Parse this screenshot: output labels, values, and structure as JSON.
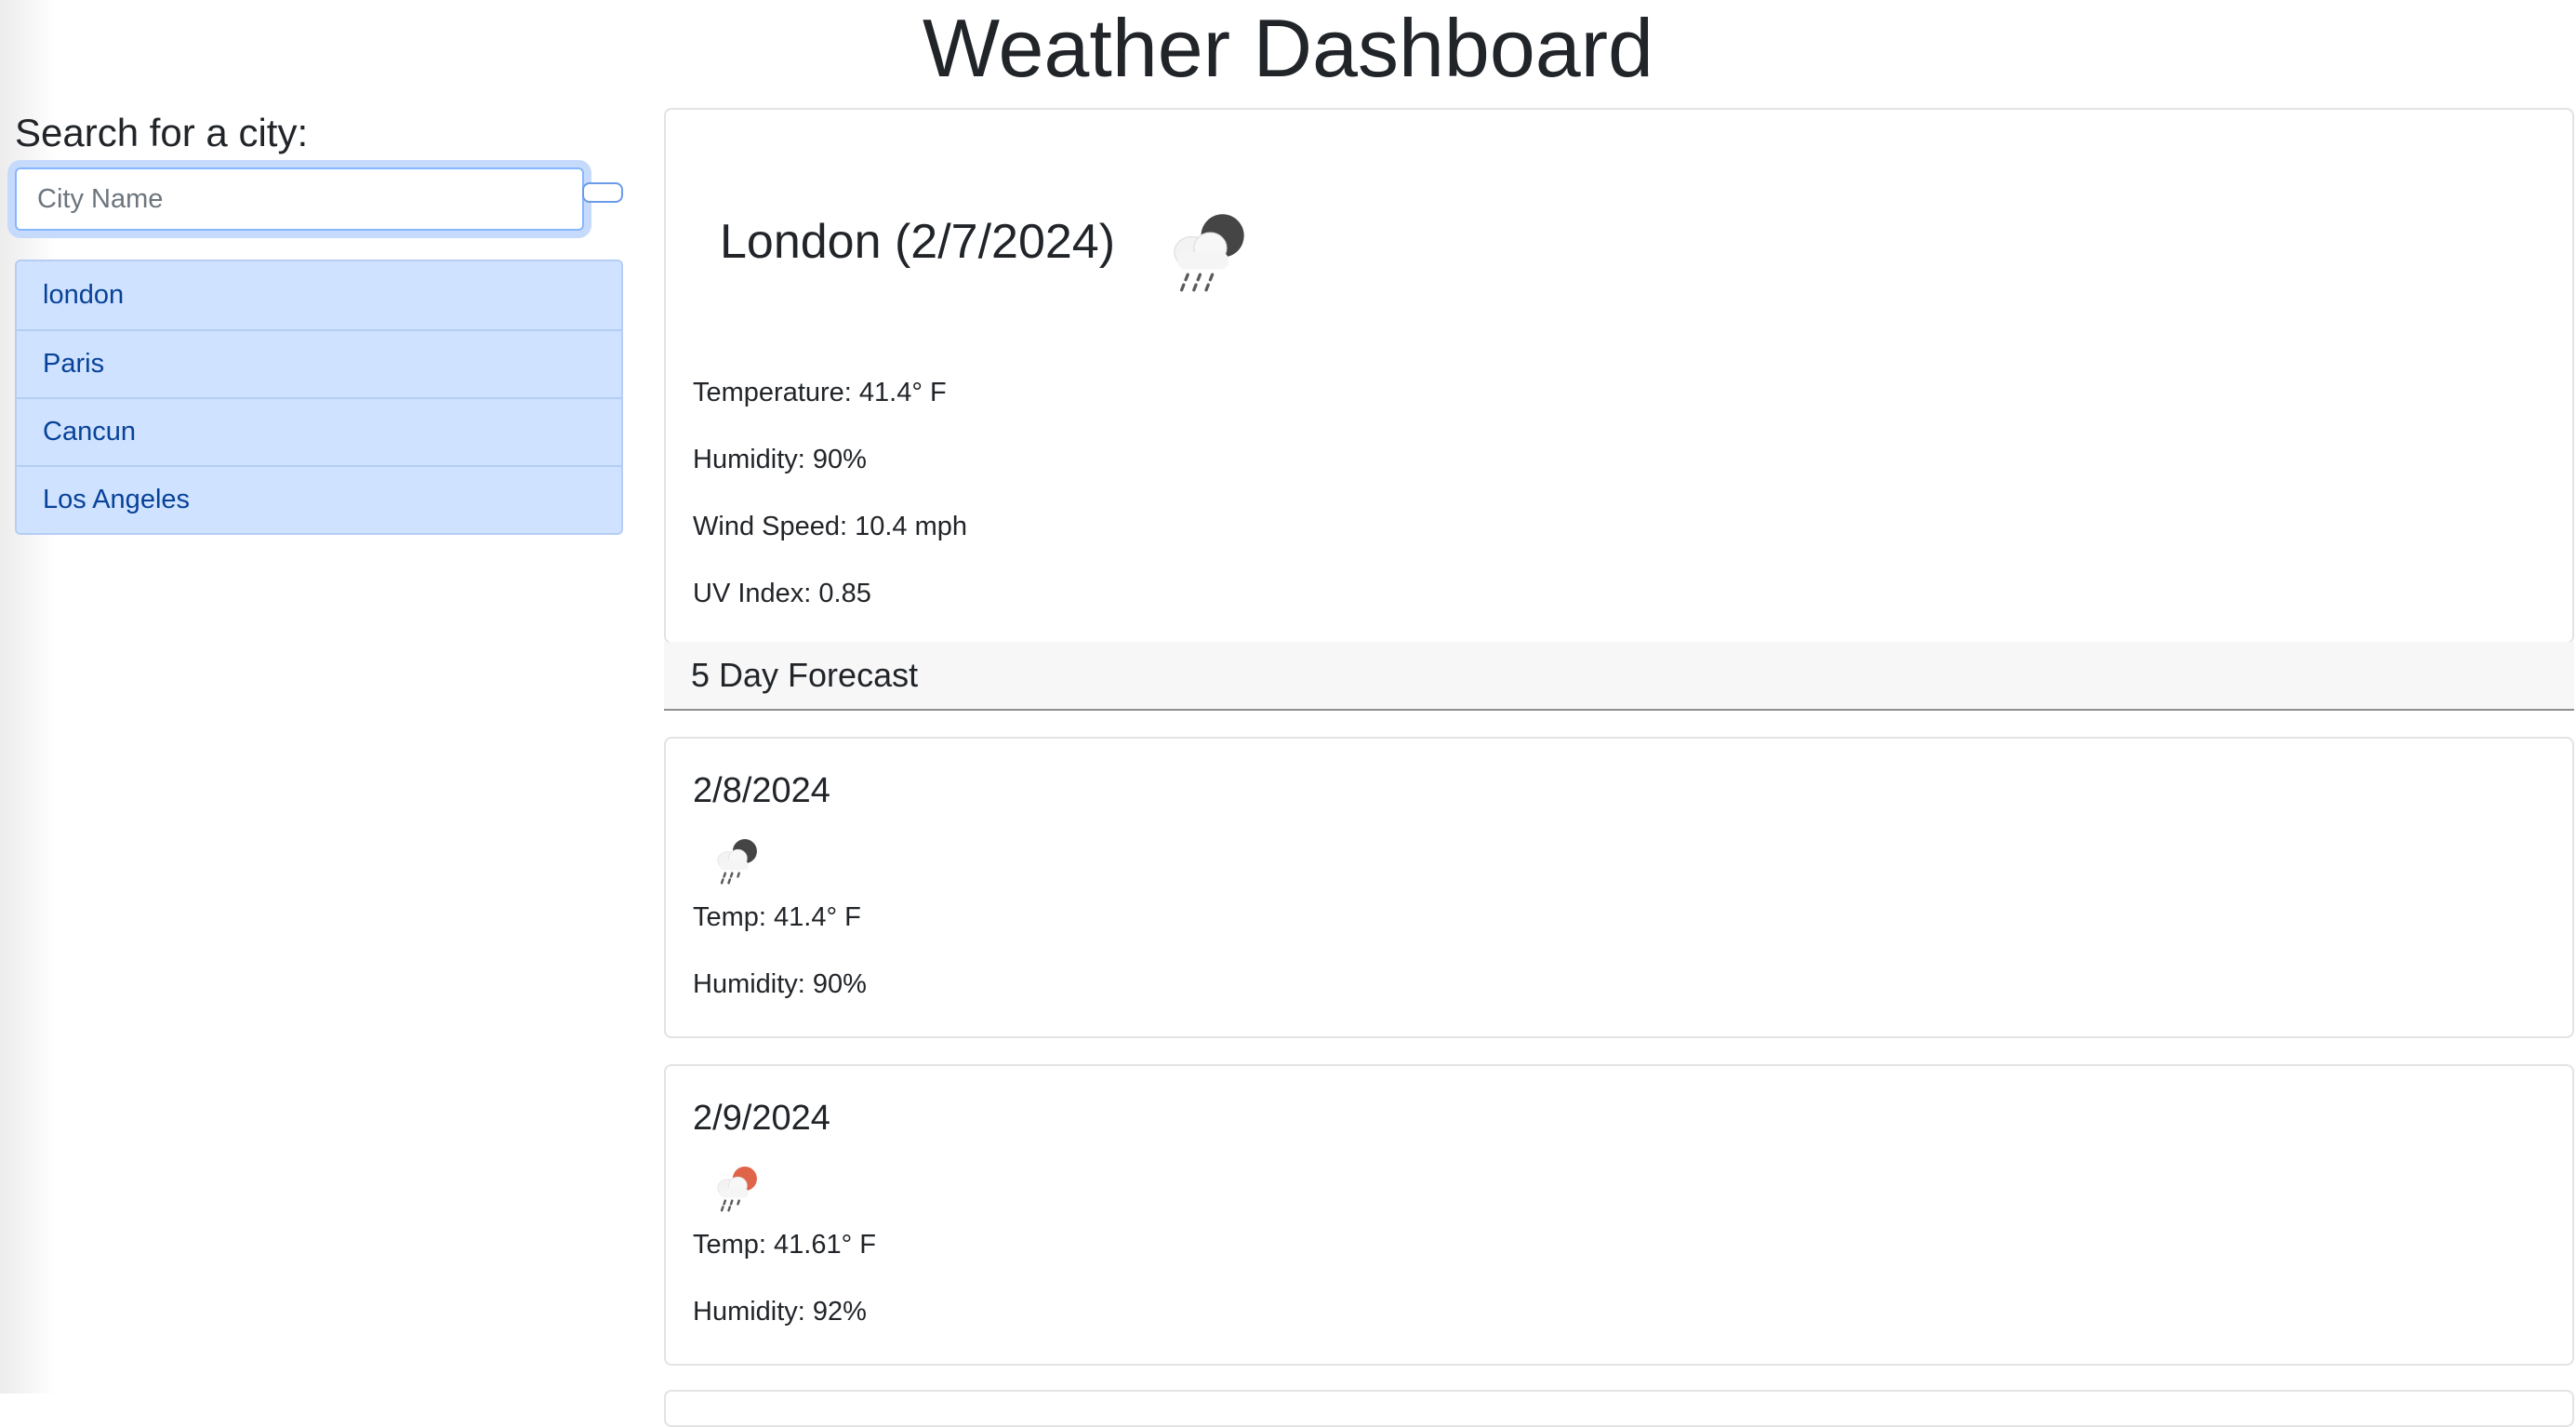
{
  "header": {
    "title": "Weather Dashboard"
  },
  "search": {
    "label": "Search for a city:",
    "placeholder": "City Name",
    "value": "",
    "button_label": ""
  },
  "history": [
    {
      "label": "london"
    },
    {
      "label": "Paris"
    },
    {
      "label": "Cancun"
    },
    {
      "label": "Los Angeles"
    }
  ],
  "current": {
    "heading": "London (2/7/2024)",
    "icon": "rain-cloud-dark-icon",
    "temperature": "Temperature: 41.4° F",
    "humidity": "Humidity: 90%",
    "wind": "Wind Speed: 10.4 mph",
    "uv": "UV Index: 0.85"
  },
  "forecast": {
    "title": "5 Day Forecast",
    "days": [
      {
        "date": "2/8/2024",
        "icon": "rain-cloud-dark-icon",
        "temp": "Temp: 41.4° F",
        "humidity": "Humidity: 90%"
      },
      {
        "date": "2/9/2024",
        "icon": "rain-cloud-sun-icon",
        "temp": "Temp: 41.61° F",
        "humidity": "Humidity: 92%"
      }
    ]
  },
  "colors": {
    "accent": "#cfe2ff",
    "accent_text": "#084298",
    "focus_ring": "#86b7fe",
    "icon_dark": "#454545",
    "icon_sun": "#e0644a"
  }
}
